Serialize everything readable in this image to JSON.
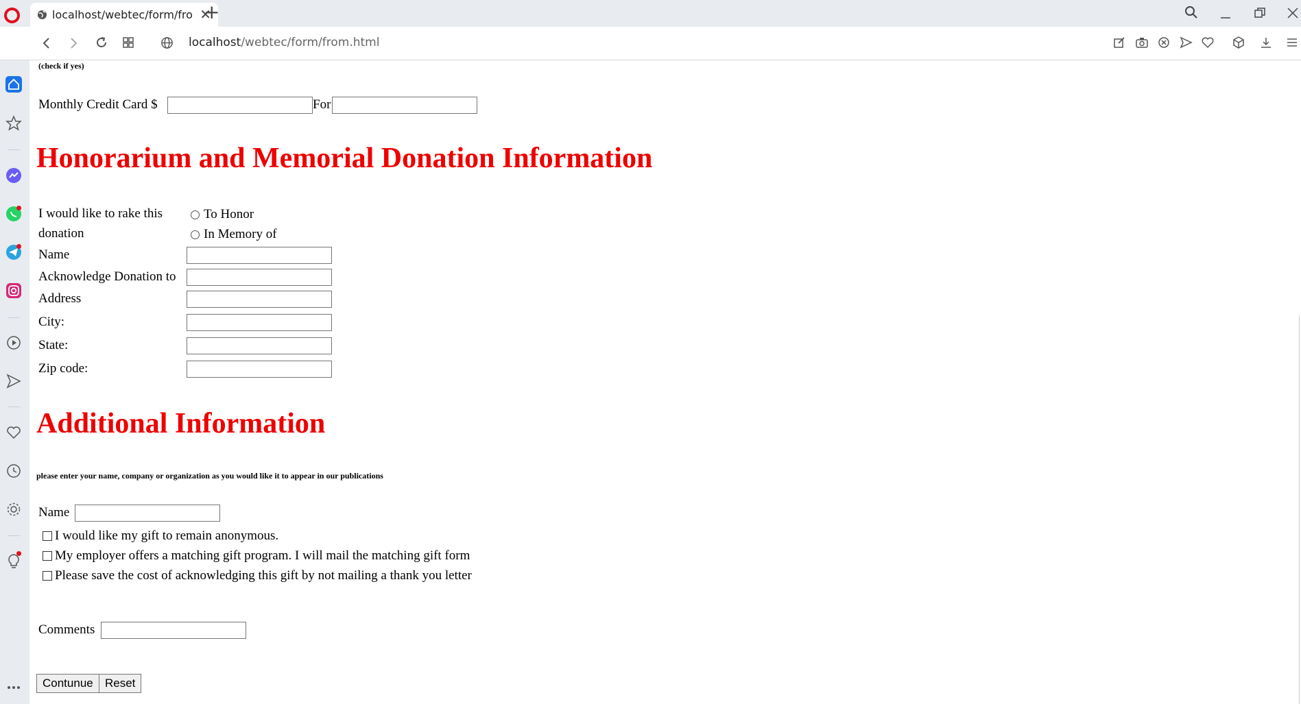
{
  "browser": {
    "tab_title": "localhost/webtec/form/fro",
    "url_host": "localhost",
    "url_path": "/webtec/form/from.html"
  },
  "page": {
    "check_note": "(check if yes)",
    "monthly_label": "Monthly Credit Card $",
    "monthly_value": "",
    "for_label": "For",
    "for_value": "",
    "honorarium_heading": "Honorarium and Memorial Donation Information",
    "donation_line1": "I would like to rake this",
    "donation_line2": "donation",
    "radio_honor": "To Honor",
    "radio_memory": "In Memory of",
    "fields": [
      {
        "label": "Name",
        "value": ""
      },
      {
        "label": "Acknowledge Donation to",
        "value": ""
      },
      {
        "label": "Address",
        "value": ""
      },
      {
        "label": "City:",
        "value": ""
      },
      {
        "label": "State:",
        "value": ""
      },
      {
        "label": "Zip code:",
        "value": ""
      }
    ],
    "additional_heading": "Additional Information",
    "publication_note": "please enter your name, company or organization as you would like it to appear in our publications",
    "name2_label": "Name",
    "name2_value": "",
    "checkboxes": [
      "I would like my gift to remain anonymous.",
      "My employer offers a matching gift program. I will mail the matching gift form",
      "Please save the cost of acknowledging this gift by not mailing a thank you letter"
    ],
    "comments_label": "Comments",
    "comments_value": "",
    "continue_label": "Contunue",
    "reset_label": "Reset"
  },
  "icons": {
    "sidebar": [
      "home-icon",
      "star-icon",
      "messenger-icon",
      "whatsapp-icon",
      "telegram-icon",
      "instagram-icon",
      "player-icon",
      "send-icon",
      "heart-icon",
      "history-icon",
      "settings-icon",
      "lightbulb-icon",
      "more-icon"
    ],
    "toolbar": [
      "edit-icon",
      "camera-icon",
      "close-circle-icon",
      "send-icon",
      "heart-icon",
      "cube-icon",
      "download-icon",
      "menu-icon"
    ]
  },
  "colors": {
    "heading": "#ee0000",
    "opera_red": "#e0101e",
    "sidebar_bg": "#e8ebf0"
  }
}
